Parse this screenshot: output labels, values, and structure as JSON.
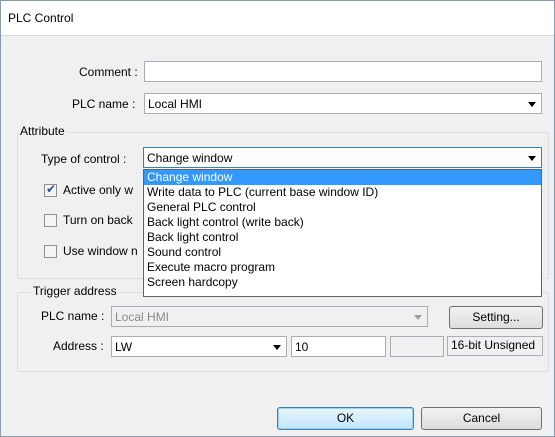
{
  "window": {
    "title": "PLC Control"
  },
  "comment": {
    "label": "Comment :",
    "value": ""
  },
  "plc_name": {
    "label": "PLC name :",
    "value": "Local HMI"
  },
  "attribute": {
    "group_title": "Attribute",
    "type_label": "Type of control :",
    "type_value": "Change window",
    "active_only_label": "Active only w",
    "active_only_checked": true,
    "turn_on_back_label": "Turn on back",
    "use_window_label": "Use window n"
  },
  "type_options": [
    "Change window",
    "Write data to PLC (current base window ID)",
    "General PLC control",
    "Back light control (write back)",
    "Back light control",
    "Sound control",
    "Execute macro program",
    "Screen hardcopy"
  ],
  "trigger": {
    "group_title": "Trigger address",
    "plc_name_label": "PLC name :",
    "plc_name_value": "Local HMI",
    "setting_button": "Setting...",
    "address_label": "Address :",
    "address_type": "LW",
    "address_value": "10",
    "format": "16-bit Unsigned"
  },
  "buttons": {
    "ok": "OK",
    "cancel": "Cancel"
  }
}
